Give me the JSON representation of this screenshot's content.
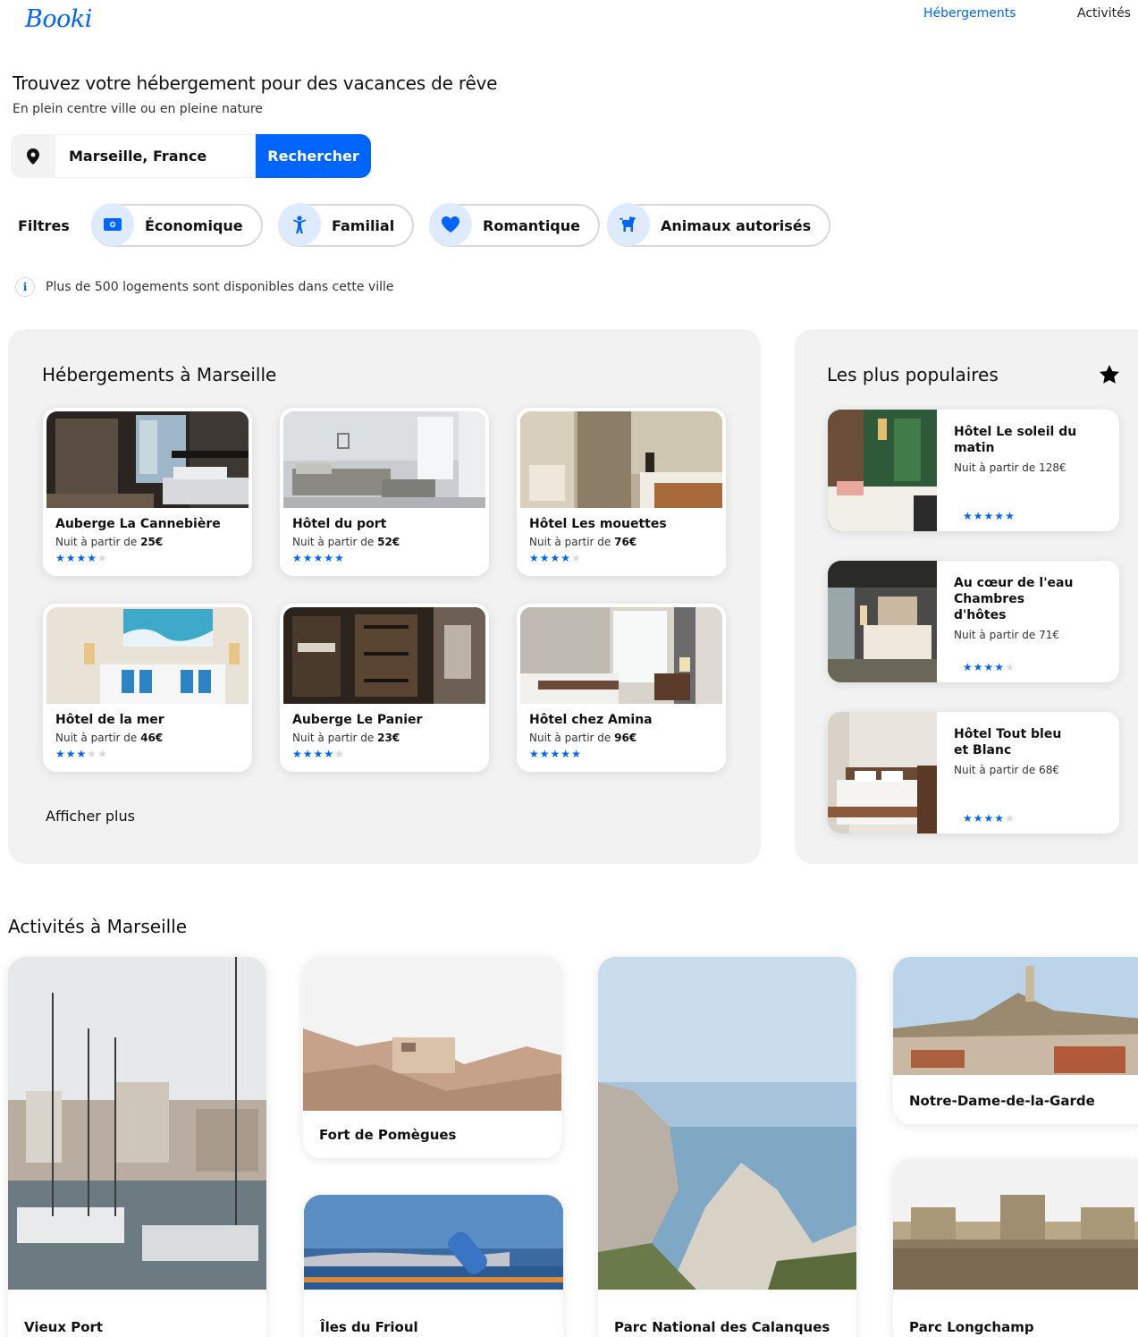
{
  "header": {
    "logo": "Booki",
    "nav": [
      {
        "label": "Hébergements",
        "active": true
      },
      {
        "label": "Activités",
        "active": false
      }
    ]
  },
  "hero": {
    "title": "Trouvez votre hébergement pour des vacances de rêve",
    "subtitle": "En plein centre ville ou en pleine nature"
  },
  "search": {
    "location_icon": "location-pin-icon",
    "value": "Marseille, France",
    "button_label": "Rechercher"
  },
  "filters": {
    "label": "Filtres",
    "items": [
      {
        "label": "Économique",
        "icon": "money-icon"
      },
      {
        "label": "Familial",
        "icon": "child-icon"
      },
      {
        "label": "Romantique",
        "icon": "heart-icon"
      },
      {
        "label": "Animaux autorisés",
        "icon": "dog-icon"
      }
    ]
  },
  "info": {
    "icon": "info-icon",
    "text": "Plus de 500 logements sont disponibles dans cette ville"
  },
  "accommodations": {
    "title": "Hébergements à Marseille",
    "price_prefix": "Nuit à partir de",
    "items": [
      {
        "name": "Auberge La Cannebière",
        "price": "25€",
        "rating": 4
      },
      {
        "name": "Hôtel du port",
        "price": "52€",
        "rating": 5
      },
      {
        "name": "Hôtel Les mouettes",
        "price": "76€",
        "rating": 4
      },
      {
        "name": "Hôtel de la mer",
        "price": "46€",
        "rating": 3
      },
      {
        "name": "Auberge Le Panier",
        "price": "23€",
        "rating": 4
      },
      {
        "name": "Hôtel chez Amina",
        "price": "96€",
        "rating": 5
      }
    ],
    "more_label": "Afficher plus"
  },
  "popular": {
    "title": "Les plus populaires",
    "icon": "star-icon",
    "items": [
      {
        "name": "Hôtel Le soleil du matin",
        "price_text": "Nuit à partir de 128€",
        "rating": 5
      },
      {
        "name": "Au cœur de l'eau Chambres d'hôtes",
        "price_text": "Nuit à partir de 71€",
        "rating": 4
      },
      {
        "name": "Hôtel Tout bleu et Blanc",
        "price_text": "Nuit à partir de 68€",
        "rating": 4
      }
    ]
  },
  "activities": {
    "title": "Activités à Marseille",
    "items": [
      {
        "name": "Vieux Port"
      },
      {
        "name": "Fort de Pomègues"
      },
      {
        "name": "Îles du Frioul"
      },
      {
        "name": "Parc National des Calanques"
      },
      {
        "name": "Notre-Dame-de-la-Garde"
      },
      {
        "name": "Parc Longchamp"
      }
    ]
  },
  "colors": {
    "primary": "#0065FC",
    "primary_light": "#DEEBFF",
    "panel_bg": "#F2F2F2",
    "star_off": "#D9D9D9"
  }
}
